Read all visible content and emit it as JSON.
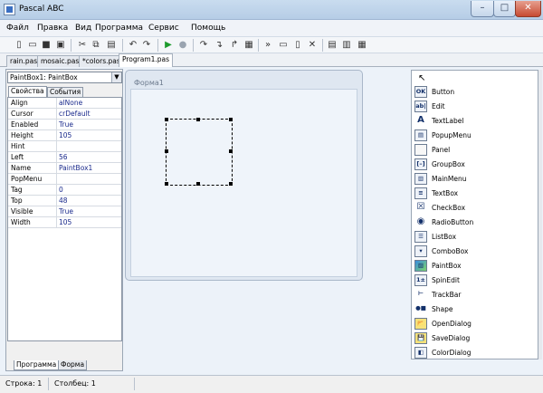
{
  "window": {
    "title": "Pascal ABC",
    "minimize": "–",
    "maximize": "□",
    "close": "✕"
  },
  "menu": [
    "Файл",
    "Правка",
    "Вид",
    "Программа",
    "Сервис",
    "Помощь"
  ],
  "toolbar_icons": [
    "new-file-icon",
    "open-folder-icon",
    "save-icon",
    "save-all-icon",
    "cut-icon",
    "copy-icon",
    "paste-icon",
    "undo-icon",
    "redo-icon",
    "run-icon",
    "stop-icon",
    "step-over-icon",
    "step-into-icon",
    "step-out-icon",
    "watch-icon",
    "evaluate-icon",
    "form-window-icon",
    "code-window-icon",
    "close-icon",
    "compile-icon",
    "build-icon",
    "rebuild-icon"
  ],
  "file_tabs": [
    {
      "label": "rain.pas",
      "active": false
    },
    {
      "label": "mosaic.pas",
      "active": false
    },
    {
      "label": "*colors.pas",
      "active": false
    },
    {
      "label": "Program1.pas",
      "active": true
    }
  ],
  "inspector": {
    "selected_component": "PaintBox1: PaintBox",
    "tabs": [
      "Свойства",
      "События"
    ],
    "properties": [
      {
        "name": "Align",
        "value": "alNone"
      },
      {
        "name": "Cursor",
        "value": "crDefault"
      },
      {
        "name": "Enabled",
        "value": "True"
      },
      {
        "name": "Height",
        "value": "105"
      },
      {
        "name": "Hint",
        "value": ""
      },
      {
        "name": "Left",
        "value": "56"
      },
      {
        "name": "Name",
        "value": "PaintBox1"
      },
      {
        "name": "PopMenu",
        "value": ""
      },
      {
        "name": "Tag",
        "value": "0"
      },
      {
        "name": "Top",
        "value": "48"
      },
      {
        "name": "Visible",
        "value": "True"
      },
      {
        "name": "Width",
        "value": "105"
      }
    ],
    "bottom_tabs": [
      "Программа",
      "Форма"
    ]
  },
  "designer": {
    "form_caption": "Форма1"
  },
  "palette": {
    "items": [
      {
        "label": "Button",
        "glyph": "OK"
      },
      {
        "label": "Edit",
        "glyph": "ab|"
      },
      {
        "label": "TextLabel",
        "glyph": "A"
      },
      {
        "label": "PopupMenu",
        "glyph": "▤"
      },
      {
        "label": "Panel",
        "glyph": ""
      },
      {
        "label": "GroupBox",
        "glyph": "[–]"
      },
      {
        "label": "MainMenu",
        "glyph": "▥"
      },
      {
        "label": "TextBox",
        "glyph": "≡"
      },
      {
        "label": "CheckBox",
        "glyph": "☒"
      },
      {
        "label": "RadioButton",
        "glyph": "◉"
      },
      {
        "label": "ListBox",
        "glyph": "☰"
      },
      {
        "label": "ComboBox",
        "glyph": "▾"
      },
      {
        "label": "PaintBox",
        "glyph": "▨"
      },
      {
        "label": "SpinEdit",
        "glyph": "1±"
      },
      {
        "label": "TrackBar",
        "glyph": "⊢"
      },
      {
        "label": "Shape",
        "glyph": "●■"
      },
      {
        "label": "OpenDialog",
        "glyph": "📂"
      },
      {
        "label": "SaveDialog",
        "glyph": "💾"
      },
      {
        "label": "ColorDialog",
        "glyph": "◧"
      }
    ]
  },
  "status": {
    "line": "Строка: 1",
    "column": "Столбец: 1"
  }
}
